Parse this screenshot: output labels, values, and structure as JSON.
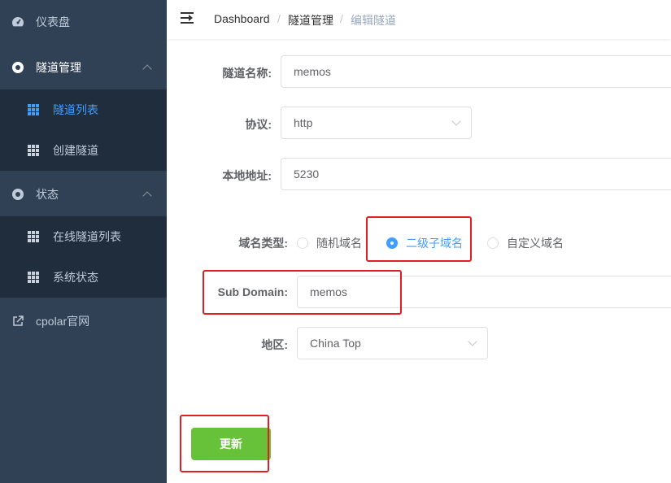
{
  "sidebar": {
    "dashboard": "仪表盘",
    "tunnel_mgmt": "隧道管理",
    "tunnel_list": "隧道列表",
    "create_tunnel": "创建隧道",
    "status": "状态",
    "online_tunnels": "在线隧道列表",
    "system_status": "系统状态",
    "website": "cpolar官网"
  },
  "breadcrumb": {
    "home": "Dashboard",
    "section": "隧道管理",
    "current": "编辑隧道",
    "separator": "/"
  },
  "form": {
    "name_label": "隧道名称:",
    "name_value": "memos",
    "protocol_label": "协议:",
    "protocol_value": "http",
    "local_label": "本地地址:",
    "local_value": "5230",
    "domain_type_label": "域名类型:",
    "domain_options": [
      "随机域名",
      "二级子域名",
      "自定义域名"
    ],
    "domain_selected": "二级子域名",
    "subdomain_label": "Sub Domain:",
    "subdomain_value": "memos",
    "region_label": "地区:",
    "region_value": "China Top",
    "submit": "更新"
  },
  "colors": {
    "sidebar_bg": "#304156",
    "submenu_bg": "#1f2d3d",
    "accent": "#409eff",
    "success": "#67c23a",
    "highlight": "#e02020"
  }
}
